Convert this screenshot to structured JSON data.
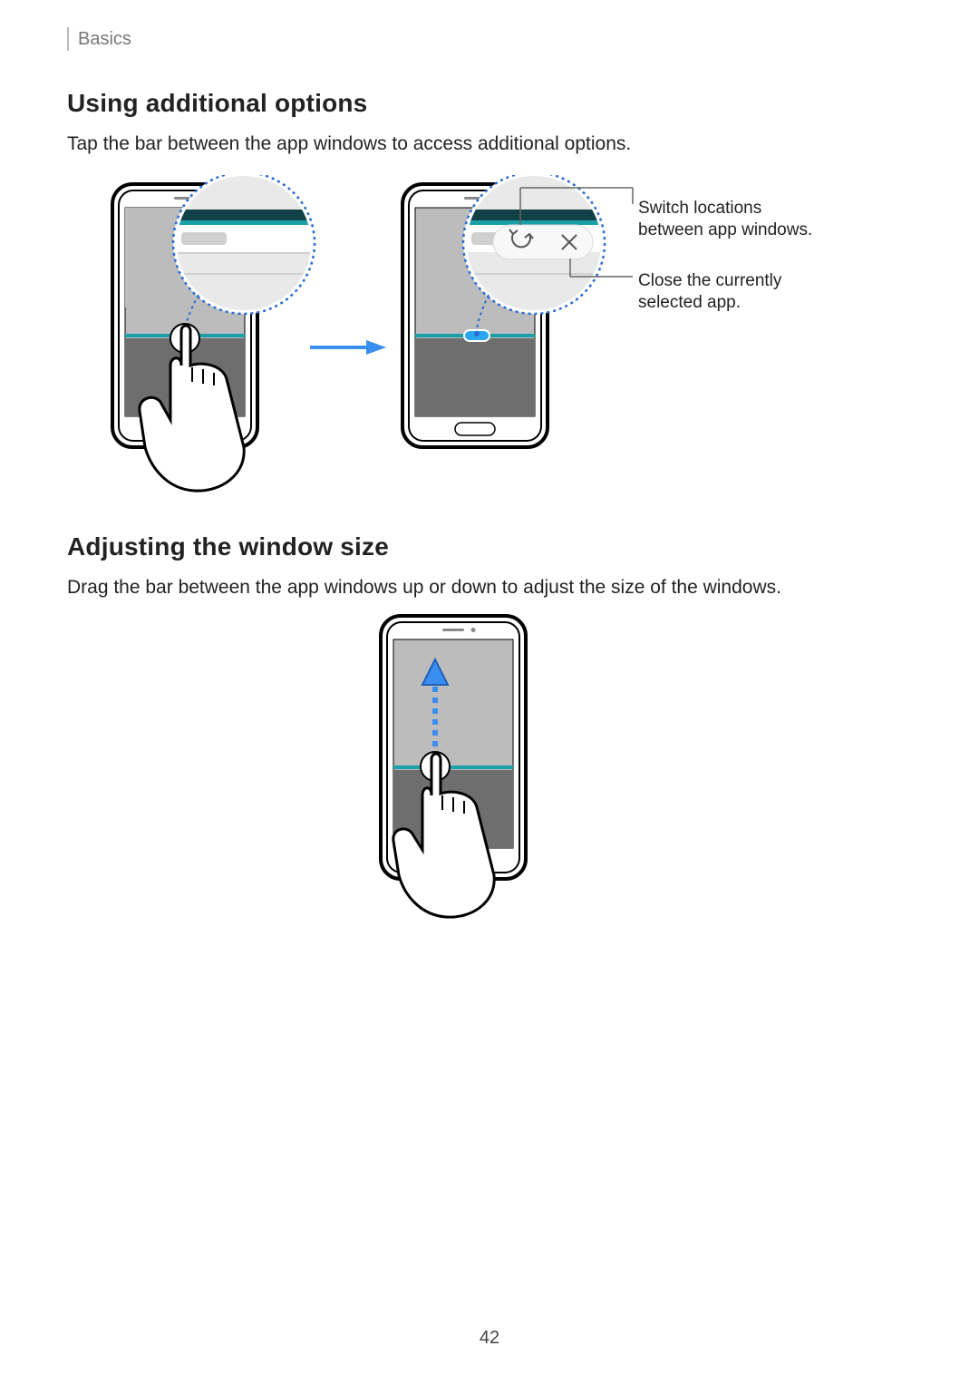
{
  "breadcrumb": "Basics",
  "section1": {
    "heading": "Using additional options",
    "body": "Tap the bar between the app windows to access additional options.",
    "callout_switch": "Switch locations between app windows.",
    "callout_close": "Close the currently selected app."
  },
  "section2": {
    "heading": "Adjusting the window size",
    "body": "Drag the bar between the app windows up or down to adjust the size of the windows."
  },
  "pageNumber": "42"
}
